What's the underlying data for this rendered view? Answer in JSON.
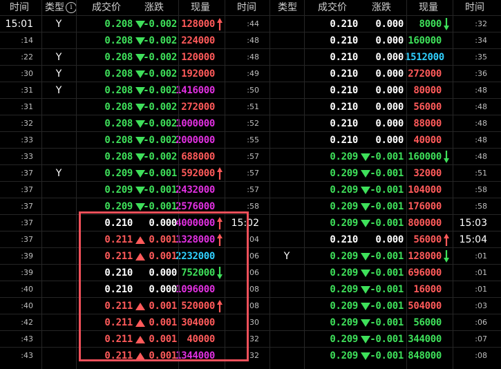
{
  "headers": {
    "left": {
      "time": "时间",
      "type": "类型",
      "info": "i",
      "price": "成交价",
      "change": "涨跌",
      "volume": "现量"
    },
    "right": {
      "time": "时间",
      "type": "类型",
      "price": "成交价",
      "change": "涨跌",
      "volume": "现量",
      "time2": "时间"
    }
  },
  "colors": {
    "up": "#ff5a5a",
    "down": "#3ee05a",
    "flat": "#ffffff",
    "magenta": "#e030e0",
    "cyan": "#30d0ff",
    "highlight": "#f0505a"
  },
  "rows": [
    {
      "lt": "15:01",
      "ltBig": true,
      "ly": "Y",
      "lp": "0.208",
      "ld": "down",
      "lc": "-0.002",
      "lv": "128000",
      "lvc": "vr",
      "la": "up",
      "mt": ":44",
      "mtBig": false,
      "ry": "",
      "rp": "0.210",
      "rd": "flat",
      "rc": "0.000",
      "rv": "8000",
      "rvc": "vg",
      "ra": "down",
      "rt": ":32",
      "rtBig": false
    },
    {
      "lt": ":14",
      "ly": "",
      "lp": "0.208",
      "ld": "down",
      "lc": "-0.002",
      "lv": "224000",
      "lvc": "vr",
      "la": "",
      "mt": ":48",
      "ry": "",
      "rp": "0.210",
      "rd": "flat",
      "rc": "0.000",
      "rv": "160000",
      "rvc": "vg",
      "ra": "",
      "rt": ":34"
    },
    {
      "lt": ":22",
      "ly": "Y",
      "lp": "0.208",
      "ld": "down",
      "lc": "-0.002",
      "lv": "120000",
      "lvc": "vr",
      "la": "",
      "mt": ":48",
      "ry": "",
      "rp": "0.210",
      "rd": "flat",
      "rc": "0.000",
      "rv": "1512000",
      "rvc": "vc",
      "ra": "",
      "rt": ":35"
    },
    {
      "lt": ":30",
      "ly": "Y",
      "lp": "0.208",
      "ld": "down",
      "lc": "-0.002",
      "lv": "192000",
      "lvc": "vr",
      "la": "",
      "mt": ":49",
      "ry": "",
      "rp": "0.210",
      "rd": "flat",
      "rc": "0.000",
      "rv": "272000",
      "rvc": "vr",
      "ra": "",
      "rt": ":36"
    },
    {
      "lt": ":31",
      "ly": "Y",
      "lp": "0.208",
      "ld": "down",
      "lc": "-0.002",
      "lv": "1416000",
      "lvc": "vm",
      "la": "",
      "mt": ":50",
      "ry": "",
      "rp": "0.210",
      "rd": "flat",
      "rc": "0.000",
      "rv": "80000",
      "rvc": "vr",
      "ra": "",
      "rt": ":48"
    },
    {
      "lt": ":31",
      "ly": "",
      "lp": "0.208",
      "ld": "down",
      "lc": "-0.002",
      "lv": "272000",
      "lvc": "vr",
      "la": "",
      "mt": ":51",
      "ry": "",
      "rp": "0.210",
      "rd": "flat",
      "rc": "0.000",
      "rv": "56000",
      "rvc": "vr",
      "ra": "",
      "rt": ":48"
    },
    {
      "lt": ":32",
      "ly": "",
      "lp": "0.208",
      "ld": "down",
      "lc": "-0.002",
      "lv": "1000000",
      "lvc": "vm",
      "la": "",
      "mt": ":52",
      "ry": "",
      "rp": "0.210",
      "rd": "flat",
      "rc": "0.000",
      "rv": "88000",
      "rvc": "vr",
      "ra": "",
      "rt": ":48"
    },
    {
      "lt": ":33",
      "ly": "",
      "lp": "0.208",
      "ld": "down",
      "lc": "-0.002",
      "lv": "2000000",
      "lvc": "vm",
      "la": "",
      "mt": ":55",
      "ry": "",
      "rp": "0.210",
      "rd": "flat",
      "rc": "0.000",
      "rv": "40000",
      "rvc": "vr",
      "ra": "",
      "rt": ":48"
    },
    {
      "lt": ":33",
      "ly": "",
      "lp": "0.208",
      "ld": "down",
      "lc": "-0.002",
      "lv": "688000",
      "lvc": "vr",
      "la": "",
      "mt": ":57",
      "ry": "",
      "rp": "0.209",
      "rd": "down",
      "rc": "-0.001",
      "rv": "160000",
      "rvc": "vg",
      "ra": "down",
      "rt": ":48"
    },
    {
      "lt": ":37",
      "ly": "Y",
      "lp": "0.209",
      "ld": "down",
      "lc": "-0.001",
      "lv": "592000",
      "lvc": "vr",
      "la": "up",
      "mt": ":57",
      "ry": "",
      "rp": "0.209",
      "rd": "down",
      "rc": "-0.001",
      "rv": "32000",
      "rvc": "vr",
      "ra": "",
      "rt": ":51"
    },
    {
      "lt": ":37",
      "ly": "",
      "lp": "0.209",
      "ld": "down",
      "lc": "-0.001",
      "lv": "2432000",
      "lvc": "vm",
      "la": "",
      "mt": ":57",
      "ry": "",
      "rp": "0.209",
      "rd": "down",
      "rc": "-0.001",
      "rv": "104000",
      "rvc": "vr",
      "ra": "",
      "rt": ":58"
    },
    {
      "lt": ":37",
      "ly": "",
      "lp": "0.209",
      "ld": "down",
      "lc": "-0.001",
      "lv": "2576000",
      "lvc": "vm",
      "la": "",
      "mt": ":58",
      "ry": "",
      "rp": "0.209",
      "rd": "down",
      "rc": "-0.001",
      "rv": "176000",
      "rvc": "vr",
      "ra": "",
      "rt": ":58"
    },
    {
      "lt": ":37",
      "ly": "",
      "lp": "0.210",
      "ld": "flat",
      "lc": "0.000",
      "lv": "4000000",
      "lvc": "vm",
      "la": "up",
      "mt": "15:02",
      "mtBig": true,
      "ry": "",
      "rp": "0.209",
      "rd": "down",
      "rc": "-0.001",
      "rv": "800000",
      "rvc": "vr",
      "ra": "",
      "rt": "15:03",
      "rtBig": true
    },
    {
      "lt": ":37",
      "ly": "",
      "lp": "0.211",
      "ld": "up",
      "lc": "0.001",
      "lv": "1328000",
      "lvc": "vm",
      "la": "up",
      "mt": ":04",
      "ry": "",
      "rp": "0.210",
      "rd": "flat",
      "rc": "0.000",
      "rv": "56000",
      "rvc": "vr",
      "ra": "up",
      "rt": "15:04",
      "rtBig": true
    },
    {
      "lt": ":39",
      "ly": "",
      "lp": "0.211",
      "ld": "up",
      "lc": "0.001",
      "lv": "2232000",
      "lvc": "vc",
      "la": "",
      "mt": ":06",
      "ry": "Y",
      "rp": "0.209",
      "rd": "down",
      "rc": "-0.001",
      "rv": "128000",
      "rvc": "vr",
      "ra": "down",
      "rt": ":01"
    },
    {
      "lt": ":39",
      "ly": "",
      "lp": "0.210",
      "ld": "flat",
      "lc": "0.000",
      "lv": "752000",
      "lvc": "vg",
      "la": "down",
      "mt": ":06",
      "ry": "",
      "rp": "0.209",
      "rd": "down",
      "rc": "-0.001",
      "rv": "696000",
      "rvc": "vr",
      "ra": "",
      "rt": ":01"
    },
    {
      "lt": ":40",
      "ly": "",
      "lp": "0.210",
      "ld": "flat",
      "lc": "0.000",
      "lv": "1096000",
      "lvc": "vm",
      "la": "",
      "mt": ":08",
      "ry": "",
      "rp": "0.209",
      "rd": "down",
      "rc": "-0.001",
      "rv": "16000",
      "rvc": "vr",
      "ra": "",
      "rt": ":01"
    },
    {
      "lt": ":40",
      "ly": "",
      "lp": "0.211",
      "ld": "up",
      "lc": "0.001",
      "lv": "520000",
      "lvc": "vr",
      "la": "up",
      "mt": ":08",
      "ry": "",
      "rp": "0.209",
      "rd": "down",
      "rc": "-0.001",
      "rv": "504000",
      "rvc": "vr",
      "ra": "",
      "rt": ":03"
    },
    {
      "lt": ":42",
      "ly": "",
      "lp": "0.211",
      "ld": "up",
      "lc": "0.001",
      "lv": "304000",
      "lvc": "vr",
      "la": "",
      "mt": ":30",
      "ry": "",
      "rp": "0.209",
      "rd": "down",
      "rc": "-0.001",
      "rv": "56000",
      "rvc": "vg",
      "ra": "",
      "rt": ":06"
    },
    {
      "lt": ":43",
      "ly": "",
      "lp": "0.211",
      "ld": "up",
      "lc": "0.001",
      "lv": "40000",
      "lvc": "vr",
      "la": "",
      "mt": ":32",
      "ry": "",
      "rp": "0.209",
      "rd": "down",
      "rc": "-0.001",
      "rv": "344000",
      "rvc": "vg",
      "ra": "",
      "rt": ":07"
    },
    {
      "lt": ":43",
      "ly": "",
      "lp": "0.211",
      "ld": "up",
      "lc": "0.001",
      "lv": "1344000",
      "lvc": "vm",
      "la": "",
      "mt": ":32",
      "ry": "",
      "rp": "0.209",
      "rd": "down",
      "rc": "-0.001",
      "rv": "848000",
      "rvc": "vg",
      "ra": "",
      "rt": ":08"
    }
  ]
}
